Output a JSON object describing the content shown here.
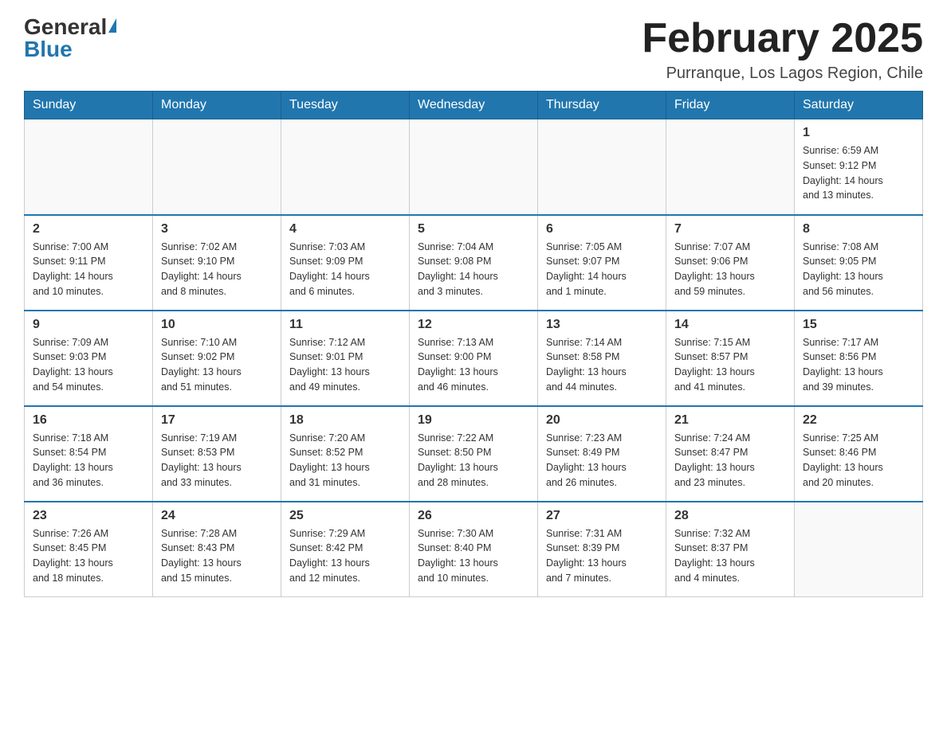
{
  "header": {
    "logo_general": "General",
    "logo_blue": "Blue",
    "month_title": "February 2025",
    "subtitle": "Purranque, Los Lagos Region, Chile"
  },
  "weekdays": [
    "Sunday",
    "Monday",
    "Tuesday",
    "Wednesday",
    "Thursday",
    "Friday",
    "Saturday"
  ],
  "weeks": [
    [
      {
        "day": "",
        "info": ""
      },
      {
        "day": "",
        "info": ""
      },
      {
        "day": "",
        "info": ""
      },
      {
        "day": "",
        "info": ""
      },
      {
        "day": "",
        "info": ""
      },
      {
        "day": "",
        "info": ""
      },
      {
        "day": "1",
        "info": "Sunrise: 6:59 AM\nSunset: 9:12 PM\nDaylight: 14 hours\nand 13 minutes."
      }
    ],
    [
      {
        "day": "2",
        "info": "Sunrise: 7:00 AM\nSunset: 9:11 PM\nDaylight: 14 hours\nand 10 minutes."
      },
      {
        "day": "3",
        "info": "Sunrise: 7:02 AM\nSunset: 9:10 PM\nDaylight: 14 hours\nand 8 minutes."
      },
      {
        "day": "4",
        "info": "Sunrise: 7:03 AM\nSunset: 9:09 PM\nDaylight: 14 hours\nand 6 minutes."
      },
      {
        "day": "5",
        "info": "Sunrise: 7:04 AM\nSunset: 9:08 PM\nDaylight: 14 hours\nand 3 minutes."
      },
      {
        "day": "6",
        "info": "Sunrise: 7:05 AM\nSunset: 9:07 PM\nDaylight: 14 hours\nand 1 minute."
      },
      {
        "day": "7",
        "info": "Sunrise: 7:07 AM\nSunset: 9:06 PM\nDaylight: 13 hours\nand 59 minutes."
      },
      {
        "day": "8",
        "info": "Sunrise: 7:08 AM\nSunset: 9:05 PM\nDaylight: 13 hours\nand 56 minutes."
      }
    ],
    [
      {
        "day": "9",
        "info": "Sunrise: 7:09 AM\nSunset: 9:03 PM\nDaylight: 13 hours\nand 54 minutes."
      },
      {
        "day": "10",
        "info": "Sunrise: 7:10 AM\nSunset: 9:02 PM\nDaylight: 13 hours\nand 51 minutes."
      },
      {
        "day": "11",
        "info": "Sunrise: 7:12 AM\nSunset: 9:01 PM\nDaylight: 13 hours\nand 49 minutes."
      },
      {
        "day": "12",
        "info": "Sunrise: 7:13 AM\nSunset: 9:00 PM\nDaylight: 13 hours\nand 46 minutes."
      },
      {
        "day": "13",
        "info": "Sunrise: 7:14 AM\nSunset: 8:58 PM\nDaylight: 13 hours\nand 44 minutes."
      },
      {
        "day": "14",
        "info": "Sunrise: 7:15 AM\nSunset: 8:57 PM\nDaylight: 13 hours\nand 41 minutes."
      },
      {
        "day": "15",
        "info": "Sunrise: 7:17 AM\nSunset: 8:56 PM\nDaylight: 13 hours\nand 39 minutes."
      }
    ],
    [
      {
        "day": "16",
        "info": "Sunrise: 7:18 AM\nSunset: 8:54 PM\nDaylight: 13 hours\nand 36 minutes."
      },
      {
        "day": "17",
        "info": "Sunrise: 7:19 AM\nSunset: 8:53 PM\nDaylight: 13 hours\nand 33 minutes."
      },
      {
        "day": "18",
        "info": "Sunrise: 7:20 AM\nSunset: 8:52 PM\nDaylight: 13 hours\nand 31 minutes."
      },
      {
        "day": "19",
        "info": "Sunrise: 7:22 AM\nSunset: 8:50 PM\nDaylight: 13 hours\nand 28 minutes."
      },
      {
        "day": "20",
        "info": "Sunrise: 7:23 AM\nSunset: 8:49 PM\nDaylight: 13 hours\nand 26 minutes."
      },
      {
        "day": "21",
        "info": "Sunrise: 7:24 AM\nSunset: 8:47 PM\nDaylight: 13 hours\nand 23 minutes."
      },
      {
        "day": "22",
        "info": "Sunrise: 7:25 AM\nSunset: 8:46 PM\nDaylight: 13 hours\nand 20 minutes."
      }
    ],
    [
      {
        "day": "23",
        "info": "Sunrise: 7:26 AM\nSunset: 8:45 PM\nDaylight: 13 hours\nand 18 minutes."
      },
      {
        "day": "24",
        "info": "Sunrise: 7:28 AM\nSunset: 8:43 PM\nDaylight: 13 hours\nand 15 minutes."
      },
      {
        "day": "25",
        "info": "Sunrise: 7:29 AM\nSunset: 8:42 PM\nDaylight: 13 hours\nand 12 minutes."
      },
      {
        "day": "26",
        "info": "Sunrise: 7:30 AM\nSunset: 8:40 PM\nDaylight: 13 hours\nand 10 minutes."
      },
      {
        "day": "27",
        "info": "Sunrise: 7:31 AM\nSunset: 8:39 PM\nDaylight: 13 hours\nand 7 minutes."
      },
      {
        "day": "28",
        "info": "Sunrise: 7:32 AM\nSunset: 8:37 PM\nDaylight: 13 hours\nand 4 minutes."
      },
      {
        "day": "",
        "info": ""
      }
    ]
  ]
}
